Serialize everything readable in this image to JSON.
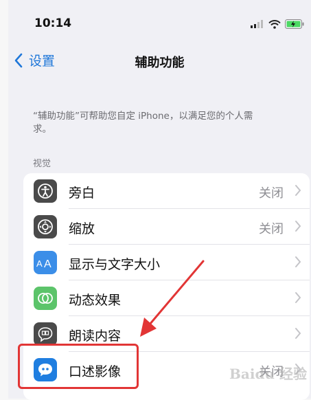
{
  "status_bar": {
    "time": "10:14",
    "icons": [
      "signal-icon",
      "wifi-icon",
      "battery-charging-icon"
    ]
  },
  "nav": {
    "back_label": "设置",
    "title": "辅助功能"
  },
  "description": "“辅助功能”可帮助您自定 iPhone，以满足您的个人需求。",
  "section_title": "视觉",
  "rows": [
    {
      "label": "旁白",
      "value": "关闭",
      "icon": "voiceover-icon",
      "icon_color": "#4a4a4a"
    },
    {
      "label": "缩放",
      "value": "关闭",
      "icon": "zoom-icon",
      "icon_color": "#4a4a4a"
    },
    {
      "label": "显示与文字大小",
      "value": "",
      "icon": "text-size-icon",
      "icon_color": "#3b8ee8"
    },
    {
      "label": "动态效果",
      "value": "",
      "icon": "motion-icon",
      "icon_color": "#5cc46a"
    },
    {
      "label": "朗读内容",
      "value": "",
      "icon": "spoken-content-icon",
      "icon_color": "#4a4a4a"
    },
    {
      "label": "口述影像",
      "value": "关闭",
      "icon": "audio-descriptions-icon",
      "icon_color": "#1f7ee0"
    }
  ],
  "annotation": {
    "arrow_color": "#e23535",
    "highlight_color": "#e23535"
  },
  "watermark": "Baidu 经验"
}
